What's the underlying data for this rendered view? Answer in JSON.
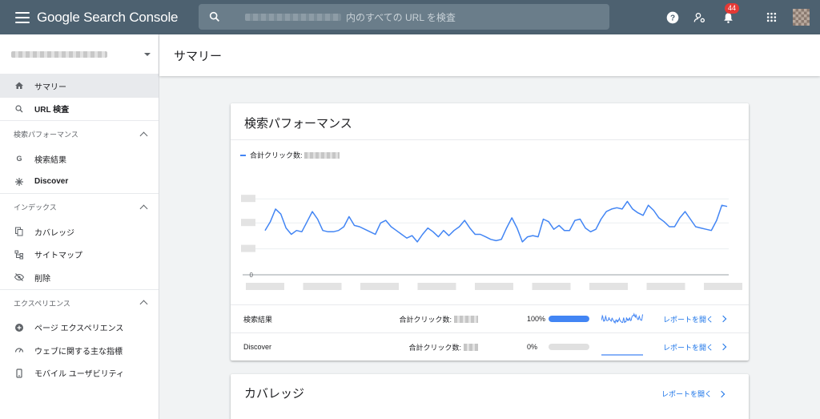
{
  "app": {
    "brand": "Google Search Console"
  },
  "search": {
    "placeholder": "内のすべての URL を検査"
  },
  "topbar": {
    "notification_count": "44"
  },
  "sidebar": {
    "main_items": [
      {
        "label": "サマリー",
        "icon": "home-icon",
        "active": true
      },
      {
        "label": "URL 検査",
        "icon": "search-icon",
        "bold": true
      }
    ],
    "sections": [
      {
        "title": "検索パフォーマンス",
        "items": [
          {
            "label": "検索結果",
            "icon": "google-g-icon"
          },
          {
            "label": "Discover",
            "icon": "asterisk-icon",
            "bold": true
          }
        ]
      },
      {
        "title": "インデックス",
        "items": [
          {
            "label": "カバレッジ",
            "icon": "copy-icon"
          },
          {
            "label": "サイトマップ",
            "icon": "sitemap-icon"
          },
          {
            "label": "削除",
            "icon": "eye-off-icon"
          }
        ]
      },
      {
        "title": "エクスペリエンス",
        "items": [
          {
            "label": "ページ エクスペリエンス",
            "icon": "plus-circle-icon"
          },
          {
            "label": "ウェブに関する主な指標",
            "icon": "gauge-icon"
          },
          {
            "label": "モバイル ユーザビリティ",
            "icon": "phone-icon"
          }
        ]
      }
    ]
  },
  "main": {
    "page_title": "サマリー"
  },
  "performance": {
    "title": "検索パフォーマンス",
    "legend": "合計クリック数:",
    "rows": [
      {
        "name": "検索結果",
        "clicks_label": "合計クリック数:",
        "percent": "100%",
        "share": 1.0,
        "open": "レポートを開く"
      },
      {
        "name": "Discover",
        "clicks_label": "合計クリック数:",
        "percent": "0%",
        "share": 0.0,
        "open": "レポートを開く"
      }
    ]
  },
  "coverage": {
    "title": "カバレッジ",
    "open": "レポートを開く"
  },
  "chart_data": {
    "type": "line",
    "series": [
      {
        "values": [
          35,
          42,
          52,
          48,
          37,
          32,
          35,
          34,
          42,
          50,
          44,
          35,
          34,
          34,
          35,
          38,
          46,
          39,
          38,
          36,
          34,
          32,
          41,
          43,
          38,
          35,
          32,
          29,
          31,
          26,
          32,
          37,
          34,
          30,
          35,
          31,
          35,
          38,
          43,
          37,
          32,
          32,
          30,
          28,
          27,
          28,
          37,
          45,
          37,
          26,
          30,
          31,
          30,
          44,
          42,
          36,
          39,
          35,
          35,
          43,
          44,
          37,
          34,
          36,
          44,
          50,
          52,
          53,
          52,
          58,
          52,
          49,
          47,
          55,
          51,
          45,
          42,
          38,
          38,
          45,
          50,
          44,
          38,
          37,
          36,
          35,
          43,
          55,
          54
        ]
      }
    ],
    "yticks": [
      "0"
    ],
    "colors": {
      "line": "#4285f4",
      "accent": "#1a73e8"
    }
  }
}
